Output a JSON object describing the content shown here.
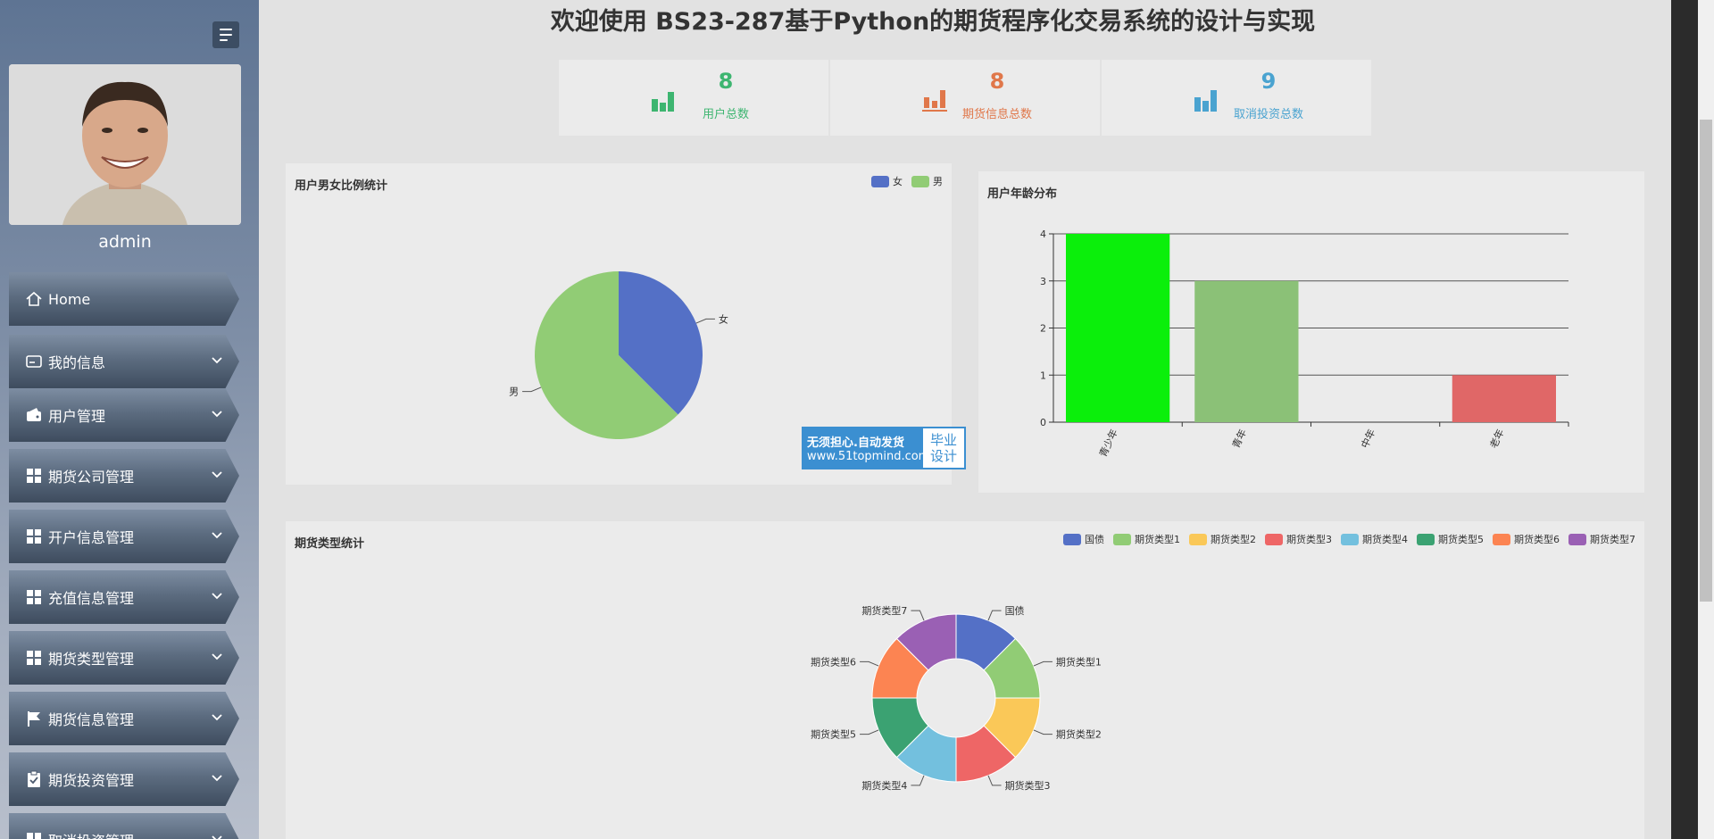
{
  "sidebar": {
    "username": "admin",
    "items": [
      {
        "label": "Home",
        "icon": "home-icon",
        "expandable": false
      },
      {
        "label": "我的信息",
        "icon": "card-icon",
        "expandable": true
      },
      {
        "label": "用户管理",
        "icon": "wallet-icon",
        "expandable": true
      },
      {
        "label": "期货公司管理",
        "icon": "grid-icon",
        "expandable": true
      },
      {
        "label": "开户信息管理",
        "icon": "grid-icon",
        "expandable": true
      },
      {
        "label": "充值信息管理",
        "icon": "grid-icon",
        "expandable": true
      },
      {
        "label": "期货类型管理",
        "icon": "grid-icon",
        "expandable": true
      },
      {
        "label": "期货信息管理",
        "icon": "flag-icon",
        "expandable": true
      },
      {
        "label": "期货投资管理",
        "icon": "clipboard-icon",
        "expandable": true
      },
      {
        "label": "取消投资管理",
        "icon": "grid-icon",
        "expandable": true
      }
    ]
  },
  "main": {
    "title": "欢迎使用 BS23-287基于Python的期货程序化交易系统的设计与实现",
    "stats": [
      {
        "value": "8",
        "label": "用户总数",
        "color": "#3db570"
      },
      {
        "value": "8",
        "label": "期货信息总数",
        "color": "#e0774a"
      },
      {
        "value": "9",
        "label": "取消投资总数",
        "color": "#4aa3d0"
      }
    ],
    "watermark": {
      "line1": "无须担心.自动发货",
      "line2": "www.51topmind.com",
      "badge1": "毕业",
      "badge2": "设计"
    }
  },
  "chart_data": [
    {
      "type": "pie",
      "title": "用户男女比例统计",
      "legend": [
        "女",
        "男"
      ],
      "legend_position": "top-right",
      "slices": [
        {
          "name": "女",
          "value": 3,
          "color": "#5470c6"
        },
        {
          "name": "男",
          "value": 5,
          "color": "#91cc75"
        }
      ]
    },
    {
      "type": "bar",
      "title": "用户年龄分布",
      "categories": [
        "青少年",
        "青年",
        "中年",
        "老年"
      ],
      "values": [
        4,
        3,
        0,
        1
      ],
      "colors": [
        "#0bef0b",
        "#8bc177",
        "#5470c6",
        "#e06767"
      ],
      "ylim": [
        0,
        4
      ],
      "yticks": [
        "0",
        "1",
        "2",
        "3",
        "4"
      ],
      "grid": true
    },
    {
      "type": "pie",
      "title": "期货类型统计",
      "legend_position": "top-right",
      "donut": true,
      "slices": [
        {
          "name": "国债",
          "value": 1,
          "color": "#5470c6"
        },
        {
          "name": "期货类型1",
          "value": 1,
          "color": "#91cc75"
        },
        {
          "name": "期货类型2",
          "value": 1,
          "color": "#fac858"
        },
        {
          "name": "期货类型3",
          "value": 1,
          "color": "#ee6666"
        },
        {
          "name": "期货类型4",
          "value": 1,
          "color": "#73c0de"
        },
        {
          "name": "期货类型5",
          "value": 1,
          "color": "#3ba272"
        },
        {
          "name": "期货类型6",
          "value": 1,
          "color": "#fc8452"
        },
        {
          "name": "期货类型7",
          "value": 1,
          "color": "#9a60b4"
        }
      ]
    }
  ]
}
